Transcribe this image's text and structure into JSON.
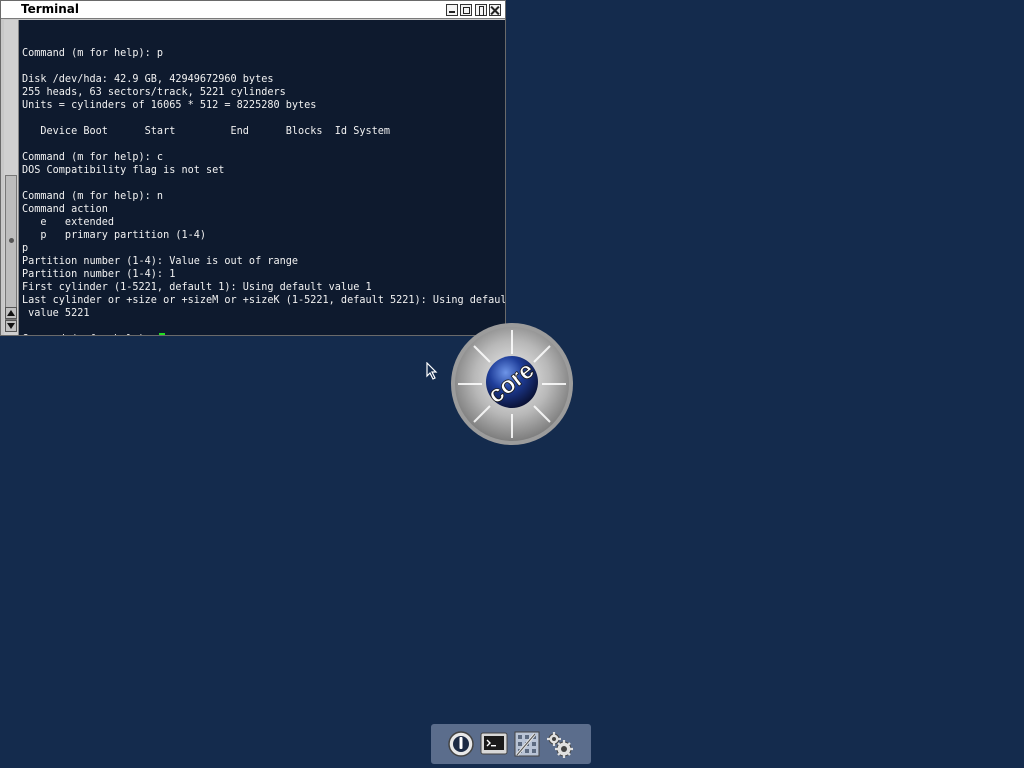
{
  "window": {
    "title": "Terminal"
  },
  "terminal": {
    "lines": [
      "",
      "Command (m for help): p",
      "",
      "Disk /dev/hda: 42.9 GB, 42949672960 bytes",
      "255 heads, 63 sectors/track, 5221 cylinders",
      "Units = cylinders of 16065 * 512 = 8225280 bytes",
      "",
      "   Device Boot      Start         End      Blocks  Id System",
      "",
      "Command (m for help): c",
      "DOS Compatibility flag is not set",
      "",
      "Command (m for help): n",
      "Command action",
      "   e   extended",
      "   p   primary partition (1-4)",
      "p",
      "Partition number (1-4): Value is out of range",
      "Partition number (1-4): 1",
      "First cylinder (1-5221, default 1): Using default value 1",
      "Last cylinder or +size or +sizeM or +sizeK (1-5221, default 5221): Using default",
      " value 5221",
      ""
    ],
    "prompt": "Command (m for help): "
  },
  "logo": {
    "text": "core"
  },
  "dock": {
    "items": [
      {
        "name": "power-icon"
      },
      {
        "name": "terminal-icon"
      },
      {
        "name": "apps-icon"
      },
      {
        "name": "settings-gears-icon"
      }
    ]
  },
  "colors": {
    "desktop": "#142b4d",
    "terminal_bg": "#0e1a2e",
    "cursor": "#22dd22"
  }
}
